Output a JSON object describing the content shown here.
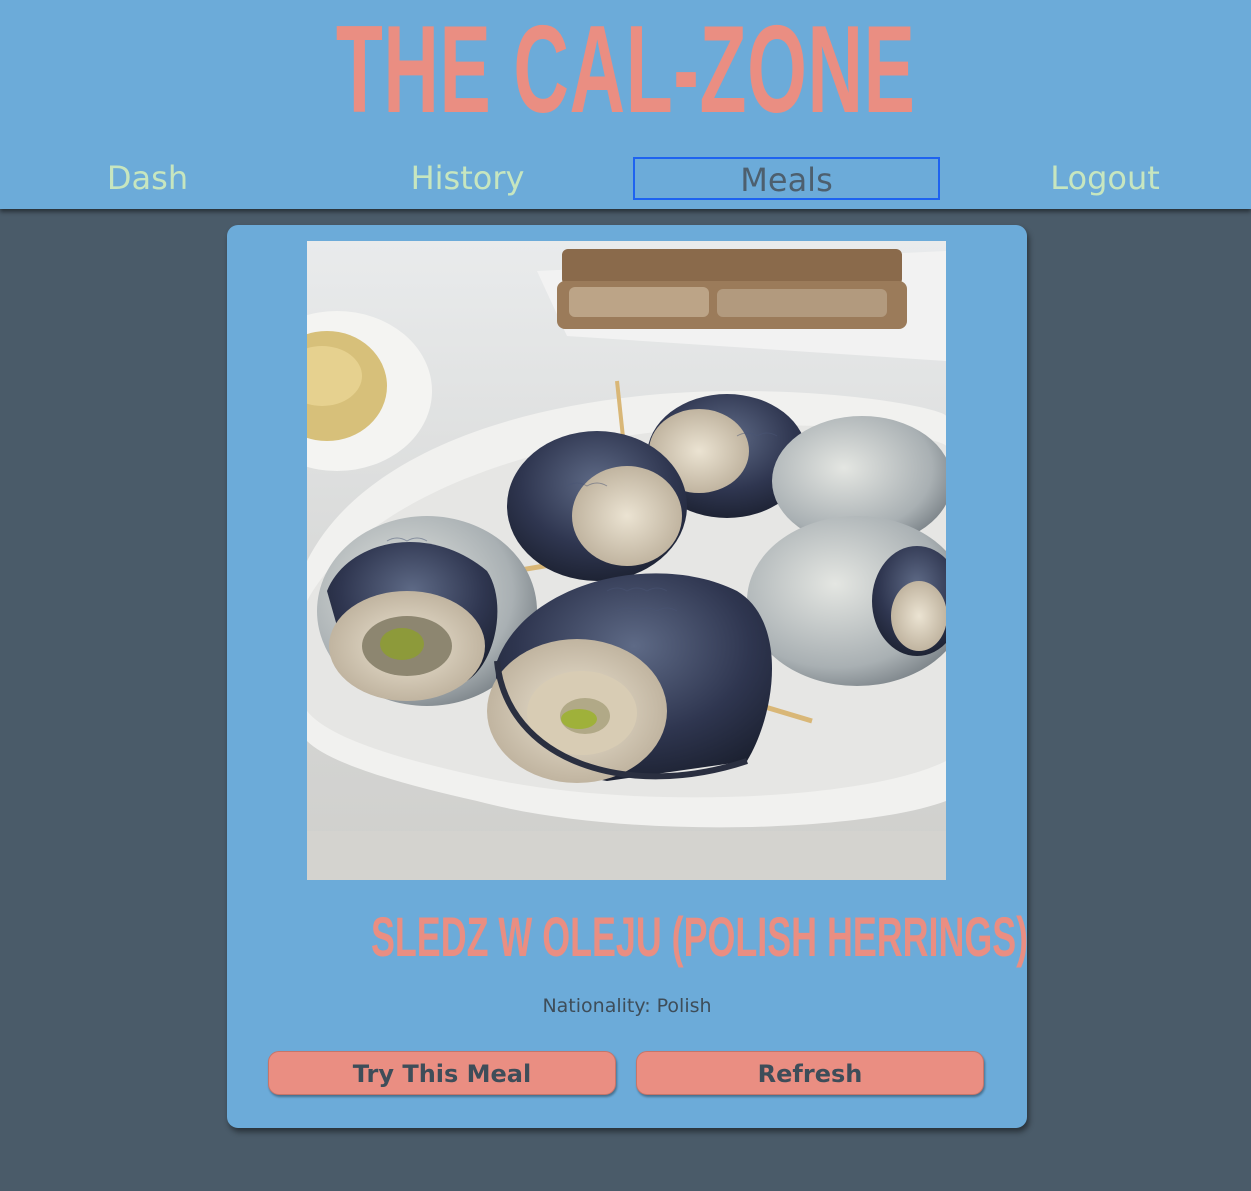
{
  "header": {
    "title": "THE CAL-ZONE"
  },
  "nav": {
    "items": [
      {
        "label": "Dash"
      },
      {
        "label": "History"
      },
      {
        "label": "Meals"
      },
      {
        "label": "Logout"
      }
    ],
    "active": "Meals"
  },
  "meal": {
    "name": "SLEDZ W OLEJU (POLISH HERRINGS)",
    "nationality": "Nationality: Polish",
    "image": "herring-rolls-photo",
    "try_label": "Try This Meal",
    "refresh_label": "Refresh"
  },
  "colors": {
    "background": "#4a5b69",
    "header": "#6cabd9",
    "accent": "#ea8e82",
    "nav_text": "#c7e6bf",
    "nav_active_text": "#4d5f6e",
    "nav_active_border": "#1e63f0"
  }
}
